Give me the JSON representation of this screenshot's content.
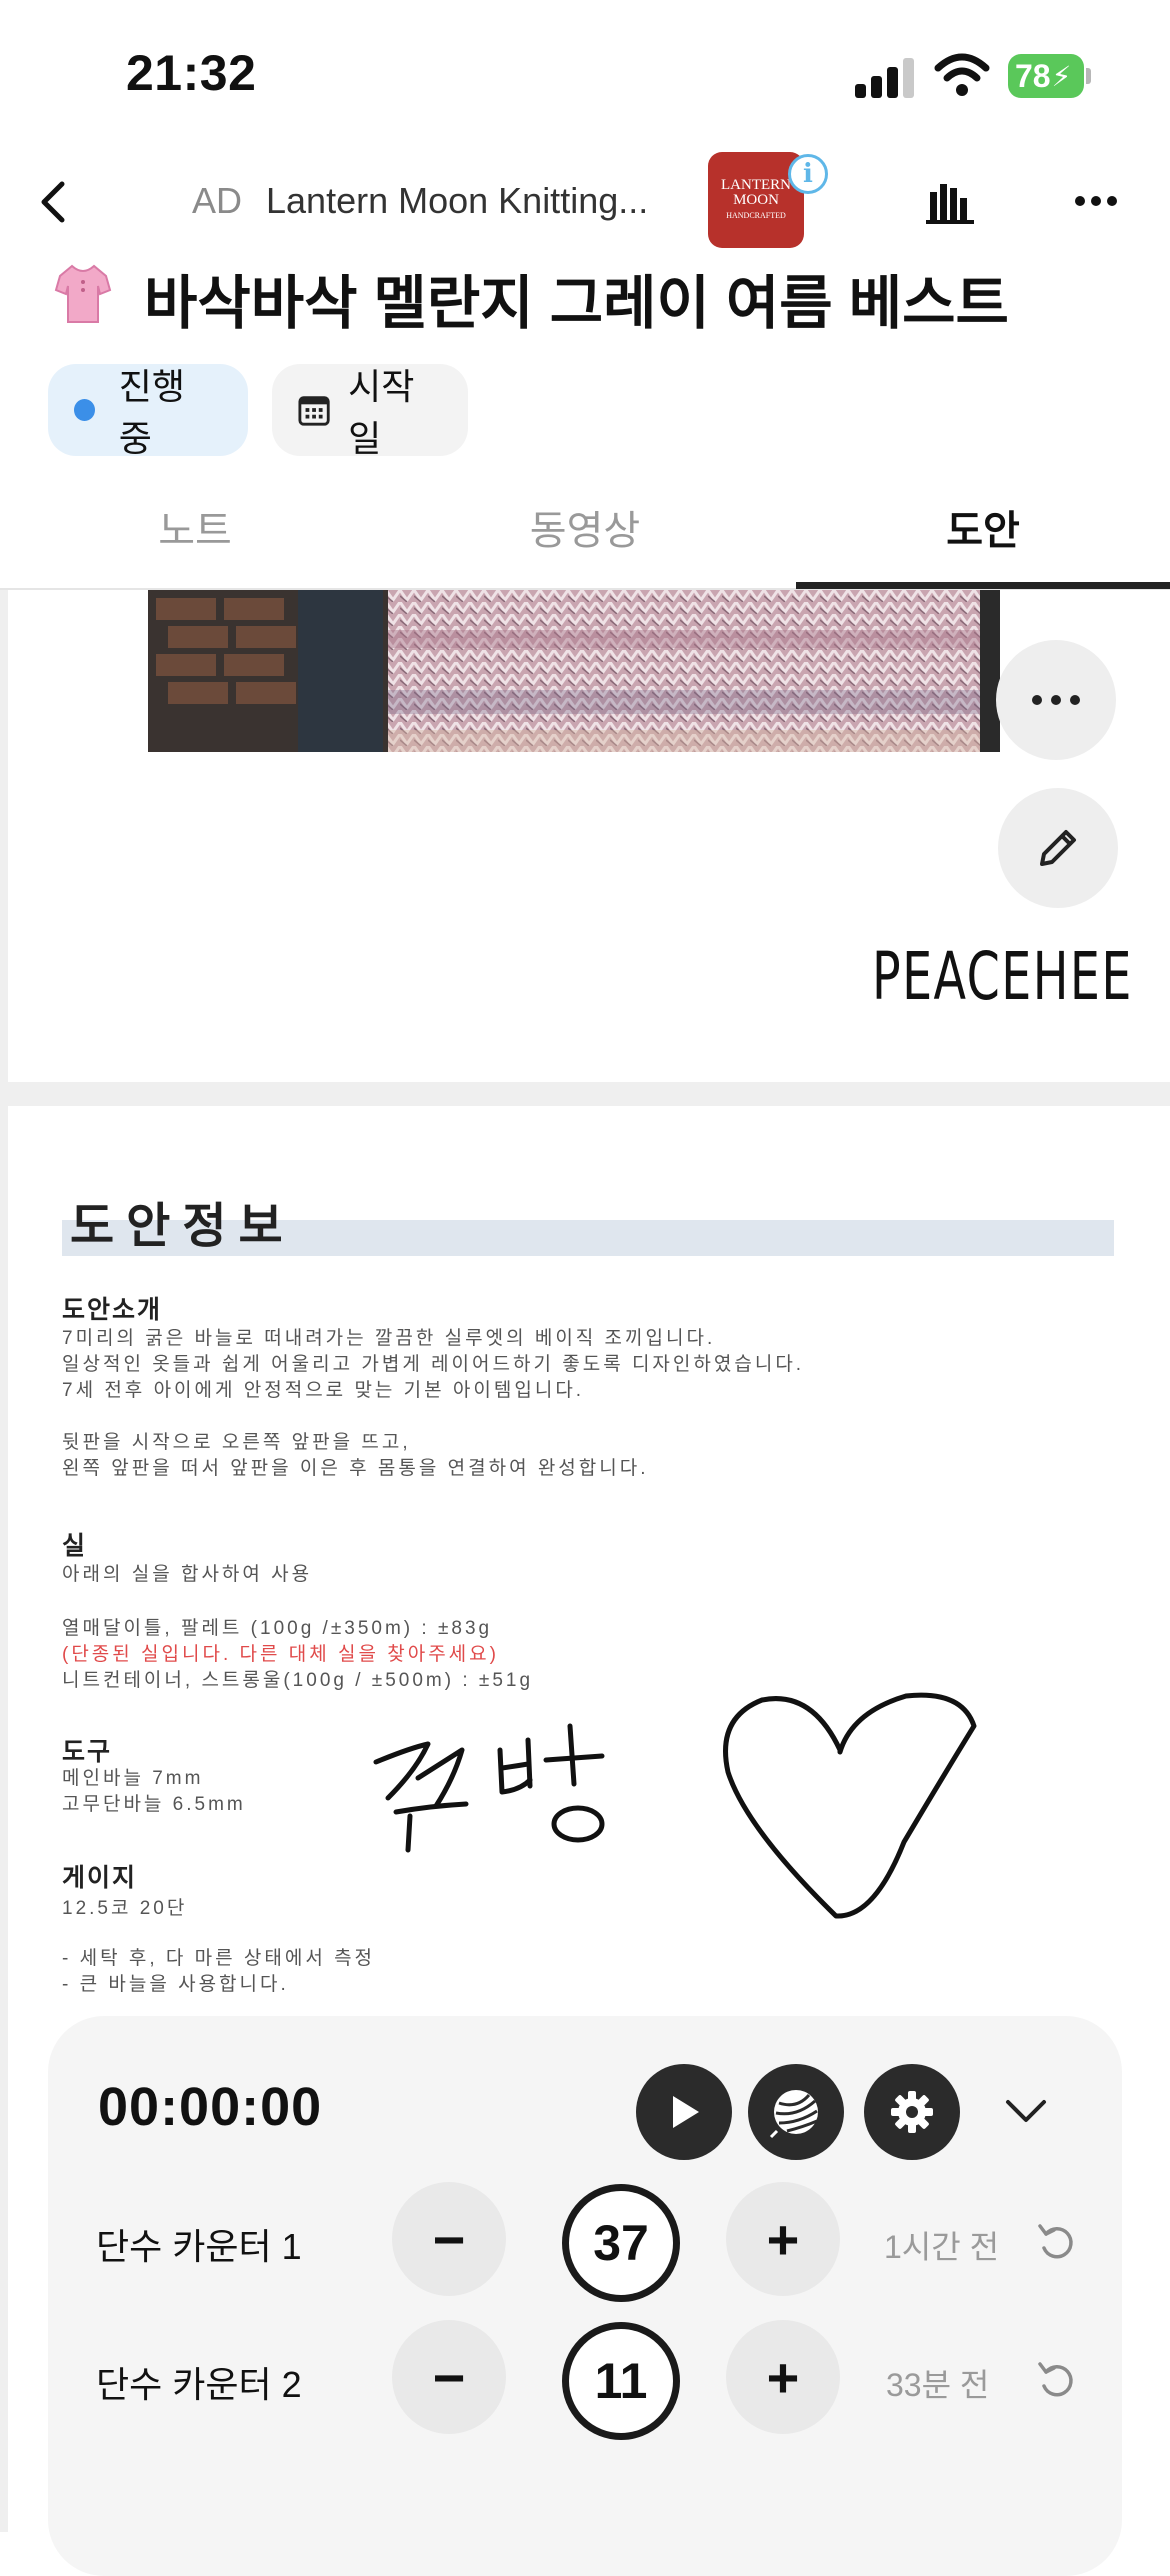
{
  "status_bar": {
    "time": "21:32",
    "battery": "78"
  },
  "ad": {
    "tag": "AD",
    "title": "Lantern Moon Knitting...",
    "logo_lines": [
      "LANTERN",
      "MOON",
      "HANDCRAFTED"
    ],
    "info_symbol": "i"
  },
  "header": {
    "title": "바삭바삭 멜란지 그레이 여름 베스트"
  },
  "chips": {
    "status": "진행 중",
    "start_date": "시작일"
  },
  "tabs": [
    {
      "label": "노트"
    },
    {
      "label": "동영상"
    },
    {
      "label": "도안"
    }
  ],
  "pattern": {
    "brand": "PEACEHEE",
    "doc_title": "도안정보",
    "sections": {
      "intro_h": "도안소개",
      "intro_1": "7미리의 굵은 바늘로 떠내려가는 깔끔한 실루엣의 베이직 조끼입니다.",
      "intro_2": "일상적인 옷들과 쉽게 어울리고 가볍게 레이어드하기 좋도록 디자인하였습니다.",
      "intro_3": "7세 전후 아이에게 안정적으로 맞는 기본 아이템입니다.",
      "intro_4": "뒷판을 시작으로 오른쪽 앞판을 뜨고,",
      "intro_5": "왼쪽 앞판을 떠서 앞판을 이은 후 몸통을 연결하여 완성합니다.",
      "yarn_h": "실",
      "yarn_1": "아래의 실을 합사하여 사용",
      "yarn_2": "열매달이틀, 팔레트 (100g /±350m) : ±83g",
      "yarn_3": "(단종된 실입니다. 다른 대체 실을 찾아주세요)",
      "yarn_4": "니트컨테이너, 스트롱울(100g / ±500m) : ±51g",
      "tools_h": "도구",
      "tools_1": "메인바늘 7mm",
      "tools_2": "고무단바늘 6.5mm",
      "gauge_h": "게이지",
      "gauge_1": "12.5코 20단",
      "gauge_2": "- 세탁 후, 다 마른 상태에서 측정",
      "gauge_3": "- 큰 바늘을 사용합니다."
    },
    "handwriting": "꾸방"
  },
  "panel": {
    "timer": "00:00:00",
    "counters": [
      {
        "label": "단수 카운터 1",
        "value": "37",
        "ago": "1시간 전"
      },
      {
        "label": "단수 카운터 2",
        "value": "11",
        "ago": "33분 전"
      }
    ],
    "minus": "−",
    "plus": "+"
  }
}
